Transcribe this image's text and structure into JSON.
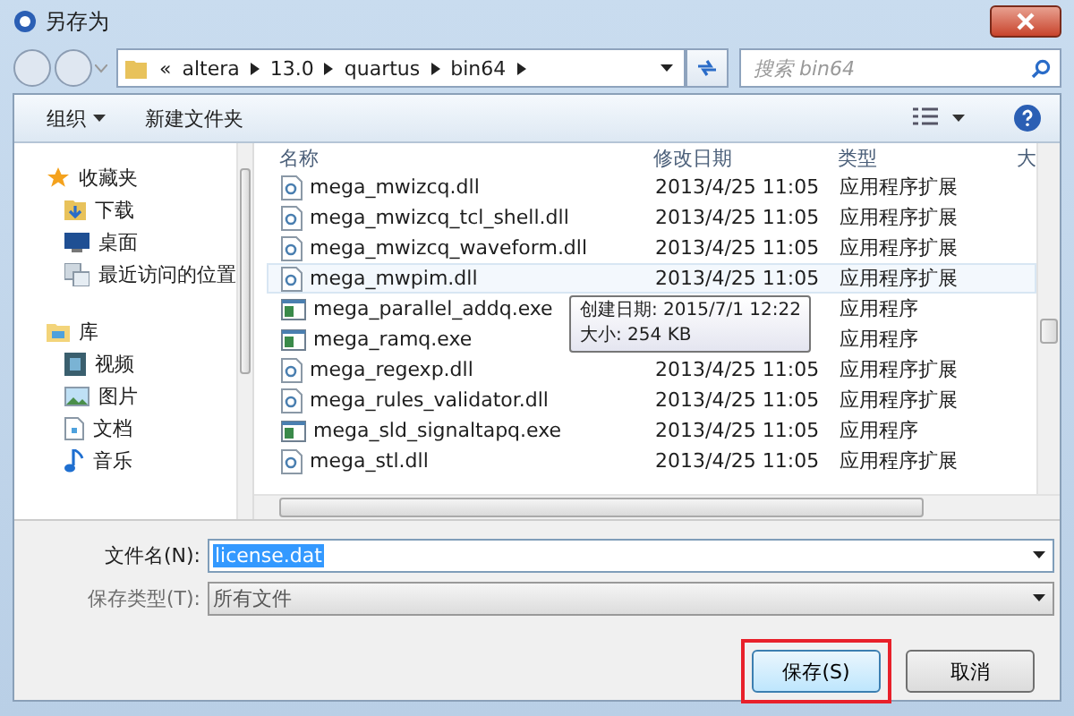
{
  "window": {
    "title": "另存为"
  },
  "address": {
    "overflow": "«",
    "path": [
      "altera",
      "13.0",
      "quartus",
      "bin64"
    ]
  },
  "search": {
    "placeholder": "搜索 bin64"
  },
  "toolbar": {
    "organize": "组织",
    "new_folder": "新建文件夹"
  },
  "sidebar": [
    {
      "label": "收藏夹",
      "kind": "star",
      "children": [
        {
          "label": "下载",
          "kind": "download"
        },
        {
          "label": "桌面",
          "kind": "desktop"
        },
        {
          "label": "最近访问的位置",
          "kind": "recent"
        }
      ]
    },
    {
      "label": "库",
      "kind": "library",
      "children": [
        {
          "label": "视频",
          "kind": "video"
        },
        {
          "label": "图片",
          "kind": "picture"
        },
        {
          "label": "文档",
          "kind": "document"
        },
        {
          "label": "音乐",
          "kind": "music"
        }
      ]
    }
  ],
  "table": {
    "columns": [
      "名称",
      "修改日期",
      "类型",
      "大"
    ],
    "rows": [
      {
        "name": "mega_mwizcq.dll",
        "kind": "dll",
        "date": "2013/4/25 11:05",
        "type": "应用程序扩展",
        "hovered": false
      },
      {
        "name": "mega_mwizcq_tcl_shell.dll",
        "kind": "dll",
        "date": "2013/4/25 11:05",
        "type": "应用程序扩展",
        "hovered": false
      },
      {
        "name": "mega_mwizcq_waveform.dll",
        "kind": "dll",
        "date": "2013/4/25 11:05",
        "type": "应用程序扩展",
        "hovered": false
      },
      {
        "name": "mega_mwpim.dll",
        "kind": "dll",
        "date": "2013/4/25 11:05",
        "type": "应用程序扩展",
        "hovered": true
      },
      {
        "name": "mega_parallel_addq.exe",
        "kind": "exe",
        "type": "应用程序",
        "hovered": false
      },
      {
        "name": "mega_ramq.exe",
        "kind": "exe",
        "type": "应用程序",
        "hovered": false
      },
      {
        "name": "mega_regexp.dll",
        "kind": "dll",
        "date": "2013/4/25 11:05",
        "type": "应用程序扩展",
        "hovered": false
      },
      {
        "name": "mega_rules_validator.dll",
        "kind": "dll",
        "date": "2013/4/25 11:05",
        "type": "应用程序扩展",
        "hovered": false
      },
      {
        "name": "mega_sld_signaltapq.exe",
        "kind": "exe",
        "date": "2013/4/25 11:05",
        "type": "应用程序",
        "hovered": false
      },
      {
        "name": "mega_stl.dll",
        "kind": "dll",
        "date": "2013/4/25 11:05",
        "type": "应用程序扩展",
        "hovered": false
      }
    ]
  },
  "tooltip": [
    "创建日期: 2015/7/1 12:22",
    "大小: 254 KB"
  ],
  "filename": {
    "label": "文件名(N):",
    "value": "license.dat"
  },
  "filetype": {
    "label": "保存类型(T):",
    "value": "所有文件"
  },
  "buttons": [
    {
      "label": "保存(S)",
      "highlighted": true
    },
    {
      "label": "取消",
      "highlighted": false
    }
  ]
}
